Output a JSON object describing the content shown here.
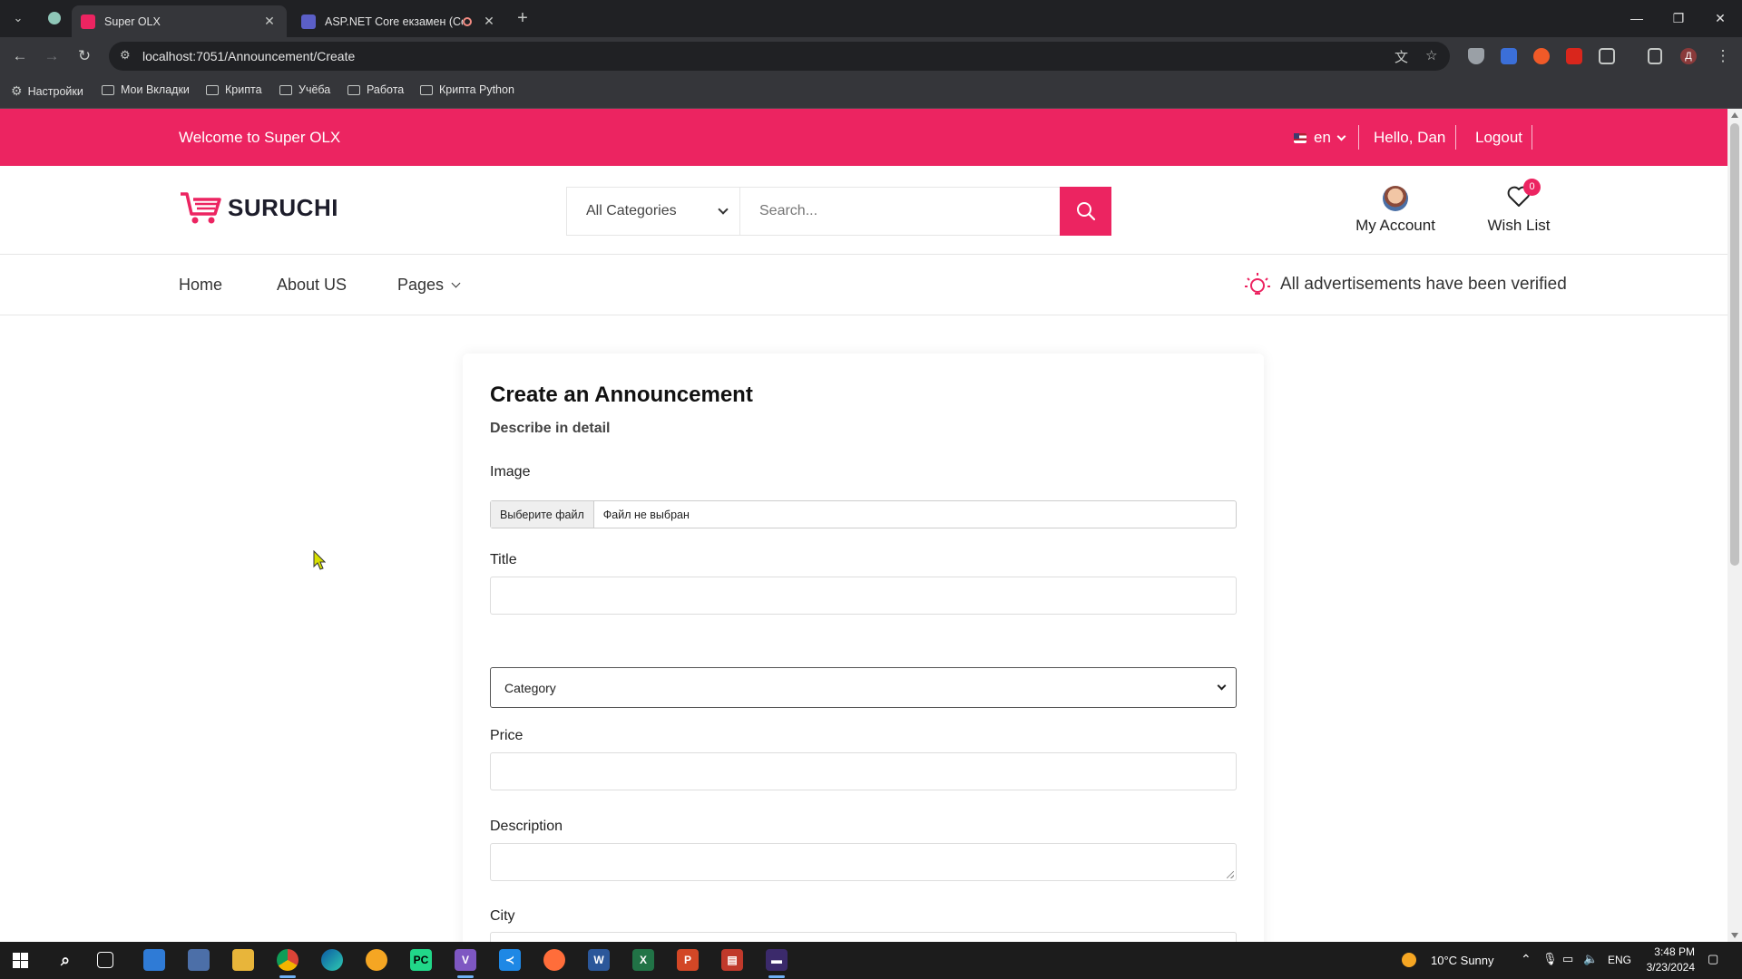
{
  "browser": {
    "tabs": [
      {
        "title": "Super OLX",
        "active": true
      },
      {
        "title": "ASP.NET Core екзамен (Co",
        "active": false
      }
    ],
    "url": "localhost:7051/Announcement/Create",
    "bookmarks": [
      "Настройки",
      "Мои Вкладки",
      "Крипта",
      "Учёба",
      "Работа",
      "Крипта Python"
    ],
    "profile_initial": "Д"
  },
  "site": {
    "topbar": {
      "welcome": "Welcome to Super OLX",
      "lang": "en",
      "hello": "Hello, Dan",
      "logout": "Logout"
    },
    "logo": "SURUCHI",
    "search": {
      "category": "All Categories",
      "placeholder": "Search..."
    },
    "account_label": "My Account",
    "wishlist_label": "Wish List",
    "wishlist_count": "0",
    "nav": {
      "home": "Home",
      "about": "About US",
      "pages": "Pages"
    },
    "verified_text": "All advertisements have been verified"
  },
  "form": {
    "title": "Create an Announcement",
    "subtitle": "Describe in detail",
    "image_label": "Image",
    "file_button": "Выберите файл",
    "file_status": "Файл не выбран",
    "title_label": "Title",
    "category_placeholder": "Category",
    "price_label": "Price",
    "description_label": "Description",
    "city_label": "City"
  },
  "taskbar": {
    "weather": "10°C  Sunny",
    "lang": "ENG",
    "time": "3:48 PM",
    "date": "3/23/2024"
  },
  "colors": {
    "brand": "#ec2461",
    "chrome_dark": "#202124",
    "chrome_toolbar": "#35363a"
  }
}
